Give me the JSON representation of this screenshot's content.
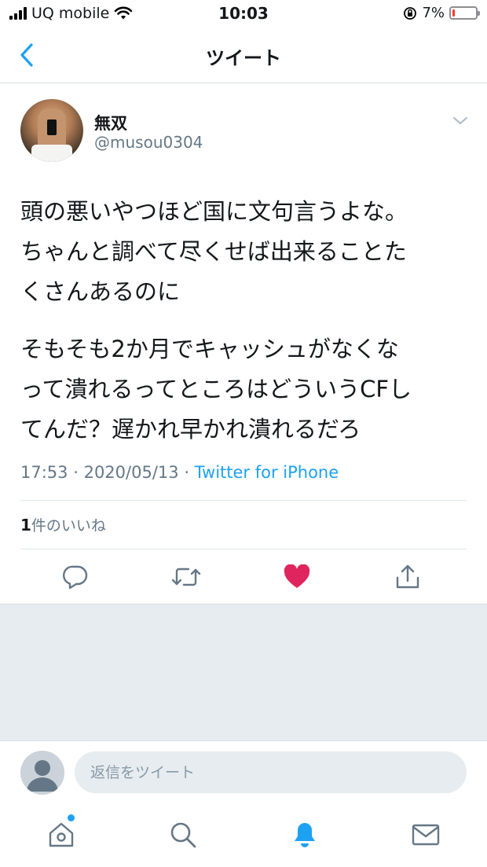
{
  "status_bar": {
    "carrier": "UQ mobile",
    "time": "10:03",
    "battery_percent": "7%",
    "battery_level": 0.07
  },
  "header": {
    "title": "ツイート",
    "back_icon": "chevron-left-icon"
  },
  "tweet": {
    "author_name": "無双",
    "author_handle": "@musou0304",
    "body_lines": [
      "頭の悪いやつほど国に文句言うよな。",
      "ちゃんと調べて尽くせば出来ることた",
      "くさんあるのに"
    ],
    "body_lines_2": [
      "そもそも2か月でキャッシュがなくな",
      "って潰れるってところはどういうCFし",
      "てんだ？遅かれ早かれ潰れるだろ"
    ],
    "time": "17:53",
    "date": "2020/05/13",
    "source": "Twitter for iPhone",
    "like_count": "1",
    "like_label": "件のいいね",
    "liked": true
  },
  "actions": {
    "reply_icon": "reply-icon",
    "retweet_icon": "retweet-icon",
    "like_icon": "heart-icon",
    "share_icon": "share-icon"
  },
  "reply_bar": {
    "placeholder": "返信をツイート"
  },
  "tab_bar": {
    "items": [
      "home-icon",
      "search-icon",
      "notifications-icon",
      "messages-icon"
    ],
    "active": "notifications-icon"
  },
  "colors": {
    "accent": "#1da1f2",
    "like": "#e0245e",
    "secondary_text": "#657786",
    "divider": "#e1e8ed",
    "timeline_bg": "#e6ecf0"
  }
}
